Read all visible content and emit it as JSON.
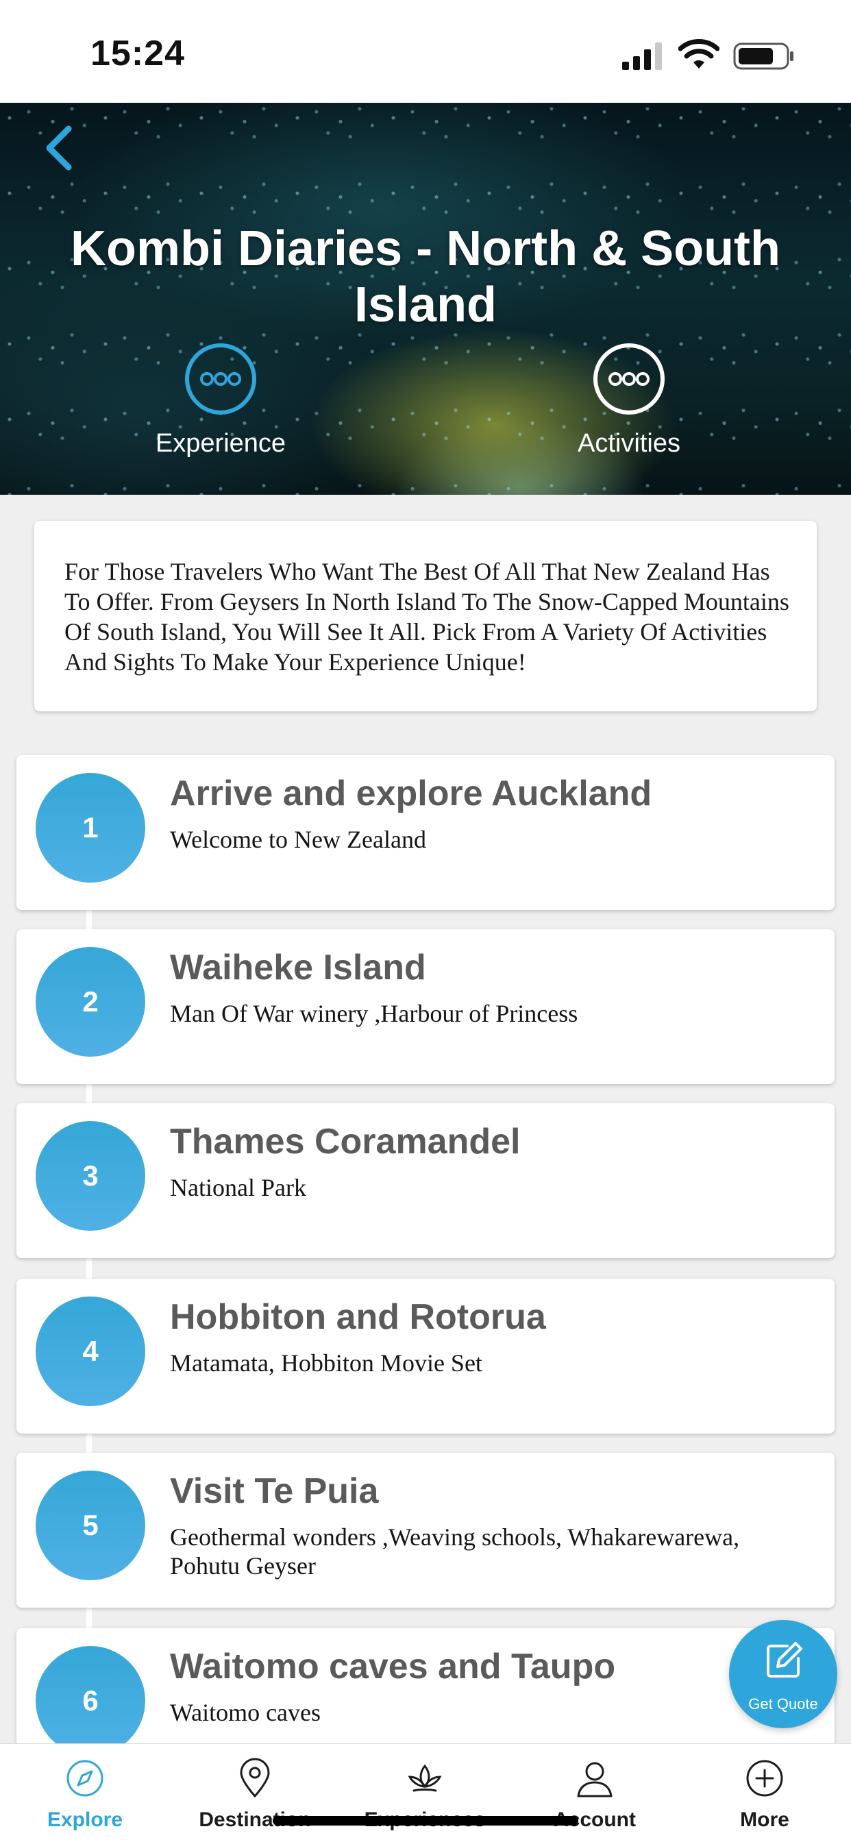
{
  "status_bar": {
    "time": "15:24"
  },
  "hero": {
    "title": "Kombi Diaries - North & South Island",
    "actions": [
      {
        "label": "Experience",
        "icon": "more-dots-icon",
        "color": "#2fa6db"
      },
      {
        "label": "Activities",
        "icon": "more-dots-icon",
        "color": "#ffffff"
      }
    ]
  },
  "description": "For Those Travelers Who Want The Best Of All That New Zealand Has To Offer. From Geysers In North Island To The Snow-Capped Mountains Of South Island, You Will See It All. Pick From A Variety Of Activities And Sights To Make Your Experience Unique!",
  "itinerary": [
    {
      "day": "1",
      "title": "Arrive and explore Auckland",
      "subtitle": "Welcome to New Zealand"
    },
    {
      "day": "2",
      "title": "Waiheke Island",
      "subtitle": "Man Of War winery ,Harbour of Princess"
    },
    {
      "day": "3",
      "title": "Thames Coramandel",
      "subtitle": "National Park"
    },
    {
      "day": "4",
      "title": "Hobbiton and Rotorua",
      "subtitle": "Matamata, Hobbiton Movie Set"
    },
    {
      "day": "5",
      "title": "Visit Te Puia",
      "subtitle": "Geothermal wonders ,Weaving schools, Whakarewarewa, Pohutu Geyser"
    },
    {
      "day": "6",
      "title": "Waitomo caves and Taupo",
      "subtitle": "Waitomo caves"
    }
  ],
  "get_quote": {
    "label": "Get Quote",
    "icon": "edit-icon"
  },
  "tab_bar": {
    "active": "Explore",
    "tabs": [
      {
        "label": "Explore",
        "icon": "compass-icon"
      },
      {
        "label": "Destination",
        "icon": "map-pin-icon"
      },
      {
        "label": "Experiences",
        "icon": "lotus-icon"
      },
      {
        "label": "Account",
        "icon": "user-icon"
      },
      {
        "label": "More",
        "icon": "plus-circle-icon"
      }
    ]
  },
  "colors": {
    "accent": "#2fa6db",
    "badge": "#3aa9dd",
    "background": "#efefef"
  }
}
